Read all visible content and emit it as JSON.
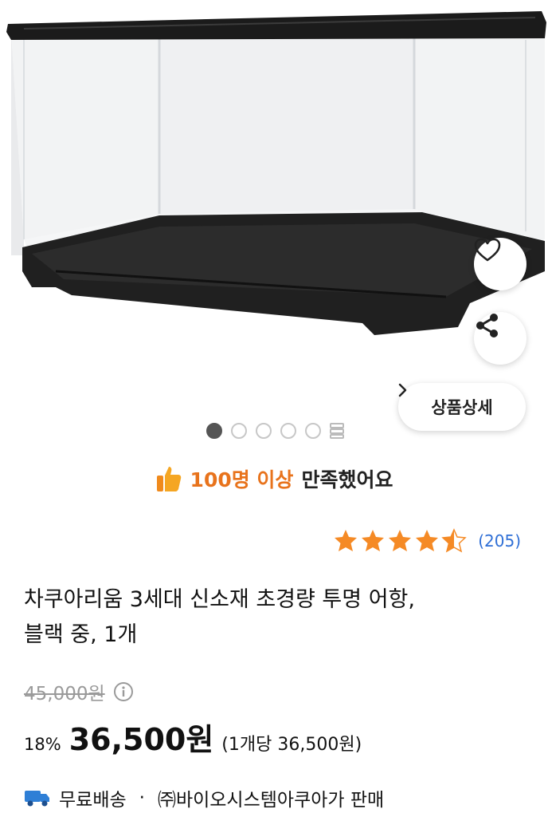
{
  "product": {
    "image_alt": "투명 어항 제품 이미지",
    "detail_button": {
      "label": "상품상세",
      "icon": "chevron-right-icon"
    },
    "actions": {
      "like_icon": "heart-icon",
      "share_icon": "share-icon"
    },
    "carousel": {
      "pages": 5,
      "active_index": 0,
      "grid_icon": "grid-icon"
    }
  },
  "satisfaction": {
    "icon": "thumbs-up-icon",
    "highlight": "100명 이상",
    "rest": "만족했어요"
  },
  "rating": {
    "stars": 4.5,
    "max": 5,
    "count": "(205)",
    "star_color": "#f58a25"
  },
  "title": {
    "line1": "차쿠아리움 3세대 신소재 초경량 투명 어항,",
    "line2": "블랙 중, 1개"
  },
  "pricing": {
    "original": "45,000원",
    "info_icon": "info-icon",
    "discount": "18%",
    "sale": "36,500원",
    "unit": "(1개당 36,500원)"
  },
  "shipping": {
    "icon": "truck-icon",
    "label": "무료배송",
    "separator": "·",
    "seller": "㈜바이오시스템아쿠아가 판매"
  },
  "colors": {
    "accent": "#e8731c",
    "link": "#2f6fd6",
    "truck": "#2f7fd6"
  }
}
